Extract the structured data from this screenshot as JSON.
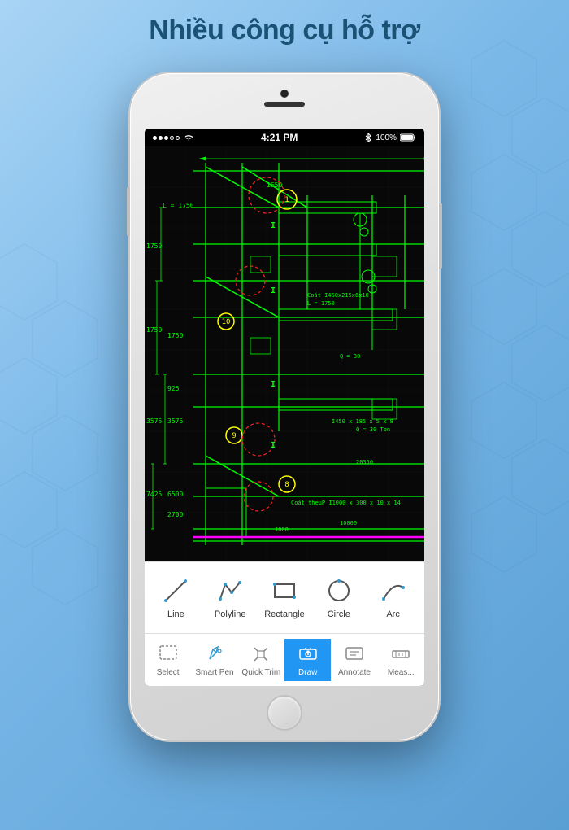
{
  "page": {
    "title": "Nhiều công cụ hỗ trợ",
    "background_color": "#7ab8e8"
  },
  "status_bar": {
    "time": "4:21 PM",
    "battery": "100%",
    "signal": "●●●○○",
    "wifi": true,
    "bluetooth": true
  },
  "draw_tools": [
    {
      "id": "line",
      "label": "Line",
      "icon": "line-icon"
    },
    {
      "id": "polyline",
      "label": "Polyline",
      "icon": "polyline-icon"
    },
    {
      "id": "rectangle",
      "label": "Rectangle",
      "icon": "rectangle-icon"
    },
    {
      "id": "circle",
      "label": "Circle",
      "icon": "circle-icon"
    },
    {
      "id": "arc",
      "label": "Arc",
      "icon": "arc-icon"
    }
  ],
  "nav_items": [
    {
      "id": "select",
      "label": "Select",
      "active": false,
      "icon": "select-icon"
    },
    {
      "id": "smart-pen",
      "label": "Smart Pen",
      "active": false,
      "icon": "pen-icon"
    },
    {
      "id": "quick-trim",
      "label": "Quick Trim",
      "active": false,
      "icon": "trim-icon"
    },
    {
      "id": "draw",
      "label": "Draw",
      "active": true,
      "icon": "draw-icon"
    },
    {
      "id": "annotate",
      "label": "Annotate",
      "active": false,
      "icon": "annotate-icon"
    },
    {
      "id": "measure",
      "label": "Meas...",
      "active": false,
      "icon": "measure-icon"
    }
  ]
}
